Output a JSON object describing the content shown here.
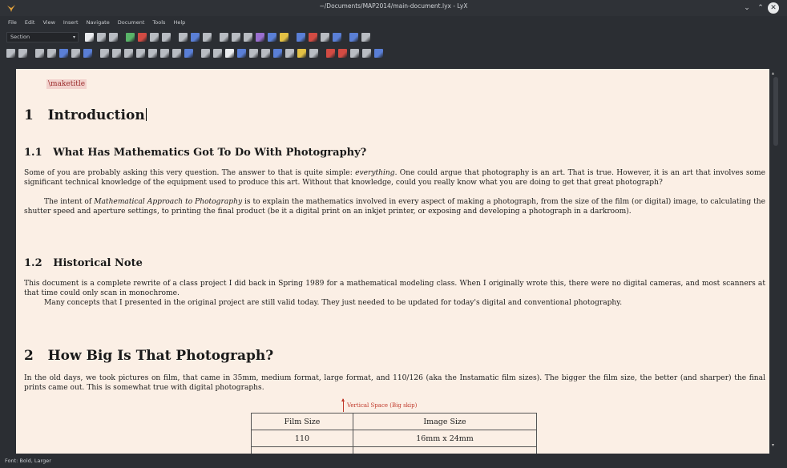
{
  "window": {
    "title": "~/Documents/MAP2014/main-document.lyx - LyX",
    "minimize_glyph": "⌄",
    "maximize_glyph": "⌃",
    "close_glyph": "✕"
  },
  "menu": [
    "File",
    "Edit",
    "View",
    "Insert",
    "Navigate",
    "Document",
    "Tools",
    "Help"
  ],
  "toolbar": {
    "layout_value": "Section",
    "layout_arrow": "▾",
    "row1_icons": [
      "new-document-icon",
      "open-icon",
      "save-icon",
      "spellcheck-icon",
      "track-changes-icon",
      "undo-icon",
      "redo-icon",
      "cut-icon",
      "copy-icon",
      "paste-icon",
      "find-icon",
      "search-icon",
      "back-icon",
      "math-icon",
      "text-style-icon",
      "bookmark-icon",
      "sum-icon",
      "table-icon",
      "grid-icon",
      "preview-icon",
      "pdf-icon",
      "dvi-icon"
    ],
    "row2_icons": [
      "quote-icon",
      "refresh-icon",
      "list-icon",
      "enum-icon",
      "description-icon",
      "indent-less-icon",
      "indent-more-icon",
      "itemize-icon",
      "paragraph-icon",
      "figure-icon",
      "table-float-icon",
      "footnote-icon",
      "marginnote-icon",
      "branch-icon",
      "box-icon",
      "label-icon",
      "reference-icon",
      "citation-icon",
      "index-icon",
      "url-icon",
      "hyperlink-icon",
      "note-icon",
      "image-icon",
      "graphics-icon",
      "pencil-icon",
      "bug-icon",
      "clip-icon",
      "view-icon",
      "compare-icon",
      "pdf-view-icon"
    ],
    "colors": {
      "blue": "#5a7fd6",
      "red": "#d24b43",
      "green": "#59b368",
      "yellow": "#e2c044",
      "gray": "#b8bcc2",
      "orange": "#e08a3c",
      "purple": "#9a6fcf",
      "white": "#e9ebee"
    }
  },
  "document": {
    "maketitle": "\\maketitle",
    "section1": {
      "number": "1",
      "title": "Introduction"
    },
    "subsection1": {
      "number": "1.1",
      "title": "What Has Mathematics Got To Do With Photography?"
    },
    "p1": {
      "before": "Some of you are probably asking this very question. The answer to that is quite simple: ",
      "em": "everything",
      "after": ". One could argue that photography is an art. That is true. However, it is an art that involves some significant technical knowledge of the equipment used to produce this art. Without that knowledge, could you really know what you are doing to get that great photograph?"
    },
    "p2": {
      "before": "The intent of ",
      "em": "Mathematical Approach to Photography",
      "after": " is to explain the mathematics involved in every aspect of making a photograph, from the size of the film (or digital) image, to calculating the shutter speed and aperture settings, to printing the final product (be it a digital print on an inkjet printer, or exposing and developing a photograph in a darkroom)."
    },
    "subsection2": {
      "number": "1.2",
      "title": "Historical Note"
    },
    "p3": "This document is a complete rewrite of a class project I did back in Spring 1989 for a mathematical modeling class. When I originally wrote this, there were no digital cameras, and most scanners at that time could only scan in monochrome.",
    "p4": "Many concepts that I presented in the original project are still valid today. They just needed to be updated for today's digital and conventional photography.",
    "section2": {
      "number": "2",
      "title": "How Big Is That Photograph?"
    },
    "p5": "In the old days, we took pictures on film, that came in 35mm, medium format, large format, and 110/126 (aka the Instamatic film sizes). The bigger the film size, the better (and sharper) the final prints came out. This is somewhat true with digital photographs.",
    "vspace_label": "Vertical Space (Big skip)",
    "table": {
      "headers": [
        "Film Size",
        "Image Size"
      ],
      "rows": [
        [
          "110",
          "16mm x 24mm"
        ]
      ]
    }
  },
  "status": "Font: Bold, Larger"
}
